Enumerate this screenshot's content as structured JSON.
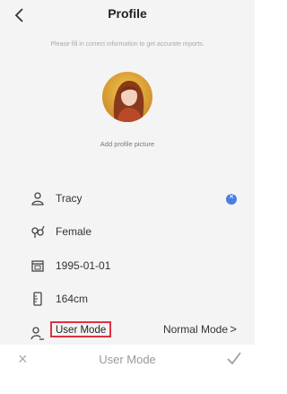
{
  "header": {
    "title": "Profile"
  },
  "hint": "Please fill in correct information to get accurate reports.",
  "avatar": {
    "add_label": "Add profile picture"
  },
  "fields": {
    "name": "Tracy",
    "gender": "Female",
    "birthday": "1995-01-01",
    "height": "164cm"
  },
  "mode": {
    "label": "User Mode",
    "value": "Normal Mode",
    "chevron": ">"
  },
  "sheet": {
    "title": "User Mode",
    "close": "×"
  },
  "colors": {
    "accent_blue": "#4a7fe0",
    "highlight_red": "#e03040"
  }
}
